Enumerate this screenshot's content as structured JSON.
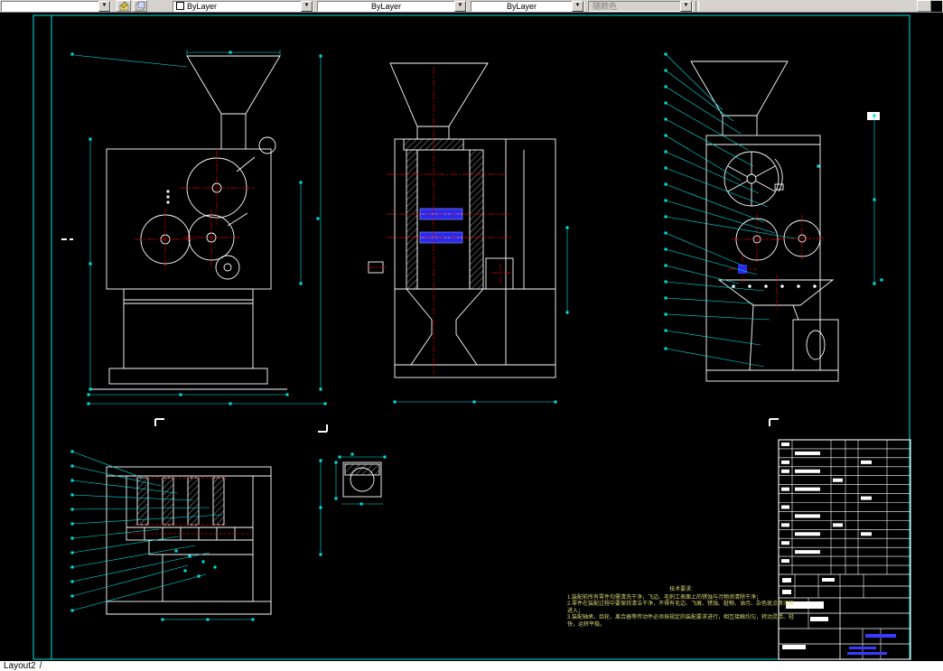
{
  "toolbar": {
    "color_value": "ByLayer",
    "linetype_value": "ByLayer",
    "lineweight_value": "ByLayer",
    "plotstyle_value": "随颜色"
  },
  "statusbar": {
    "layout_tab": "Layout2",
    "tab_divider": "/"
  },
  "notes": {
    "title": "技术要求:",
    "lines": [
      "1.装配前所有零件均需清洗干净，飞边、毛刺工表面上的锈蚀与污物须清除干净；",
      "2.零件在装配过程中要保持清洁干净，不得有毛边、飞屑、锈蚀、脏物、油污、杂色斑点等污物进入；",
      "3.装配轴承、齿轮、离合器等传动件必须按规定的装配要求进行，相互接触均匀，转动灵活、轻快，运转平稳。"
    ]
  },
  "colors": {
    "cad_cyan": "#00e5e5",
    "cad_red": "#d40000",
    "cad_blue": "#2a2aee",
    "cad_white": "#ffffff",
    "notes_yellow": "#d8d878"
  }
}
